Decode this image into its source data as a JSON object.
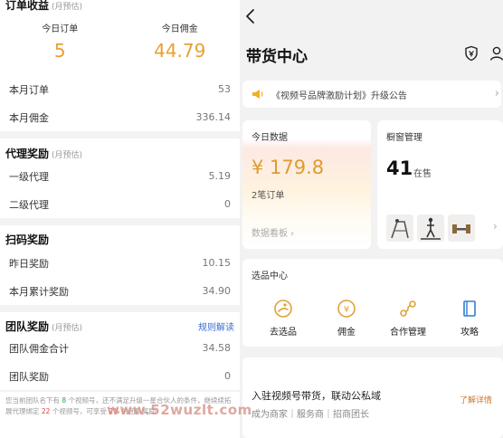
{
  "left": {
    "order_income": {
      "title": "订单收益",
      "sub": "(月预估)"
    },
    "today_order_label": "今日订单",
    "today_order_value": "5",
    "today_commission_label": "今日佣金",
    "today_commission_value": "44.79",
    "month_order_label": "本月订单",
    "month_order_value": "53",
    "month_commission_label": "本月佣金",
    "month_commission_value": "336.14",
    "agent_reward": {
      "title": "代理奖励",
      "sub": "(月预估)"
    },
    "level1_label": "一级代理",
    "level1_value": "5.19",
    "level2_label": "二级代理",
    "level2_value": "0",
    "scan_reward": {
      "title": "扫码奖励"
    },
    "yesterday_label": "昨日奖励",
    "yesterday_value": "10.15",
    "month_total_label": "本月累计奖励",
    "month_total_value": "34.90",
    "team_reward": {
      "title": "团队奖励",
      "sub": "(月预估)",
      "link": "规则解读"
    },
    "team_total_label": "团队佣金合计",
    "team_total_value": "34.58",
    "team_reward_label": "团队奖励",
    "team_reward_value": "0",
    "note": {
      "p1": "您当前团队名下有 ",
      "n1": "8",
      "p2": " 个视频号，还不满足升级一星合伙人的条件，继续续拓展代理绑定 ",
      "n2": "22",
      "p3": " 个视频号，可享受 ",
      "n3": "2%",
      "p4": " 的团队奖励"
    }
  },
  "right": {
    "title": "带货中心",
    "notice_text": "《视频号品牌激励计划》升级公告",
    "today_data": {
      "title": "今日数据",
      "amount": "¥ 179.8",
      "orders": "2笔订单",
      "link": "数据看板 ›"
    },
    "window": {
      "title": "橱窗管理",
      "count": "41",
      "status": "在售"
    },
    "tools": {
      "title": "选品中心",
      "items": [
        {
          "label": "去选品",
          "icon": "selection-icon"
        },
        {
          "label": "佣金",
          "icon": "yen-coin-icon"
        },
        {
          "label": "合作管理",
          "icon": "link-node-icon"
        },
        {
          "label": "攻略",
          "icon": "book-icon"
        }
      ]
    },
    "join": {
      "title": "入驻视频号带货，联动公私域",
      "subtitle": "成为商家｜服务商｜招商团长",
      "button": "了解详情"
    },
    "watermark": "www.52wuzlt.com"
  },
  "colors": {
    "accent_orange": "#e8a033",
    "link_blue": "#3a6fd0",
    "green": "#2ba34a",
    "red": "#e24040",
    "tool_orange": "#e0a23a",
    "tool_blue": "#2f7fd0"
  }
}
